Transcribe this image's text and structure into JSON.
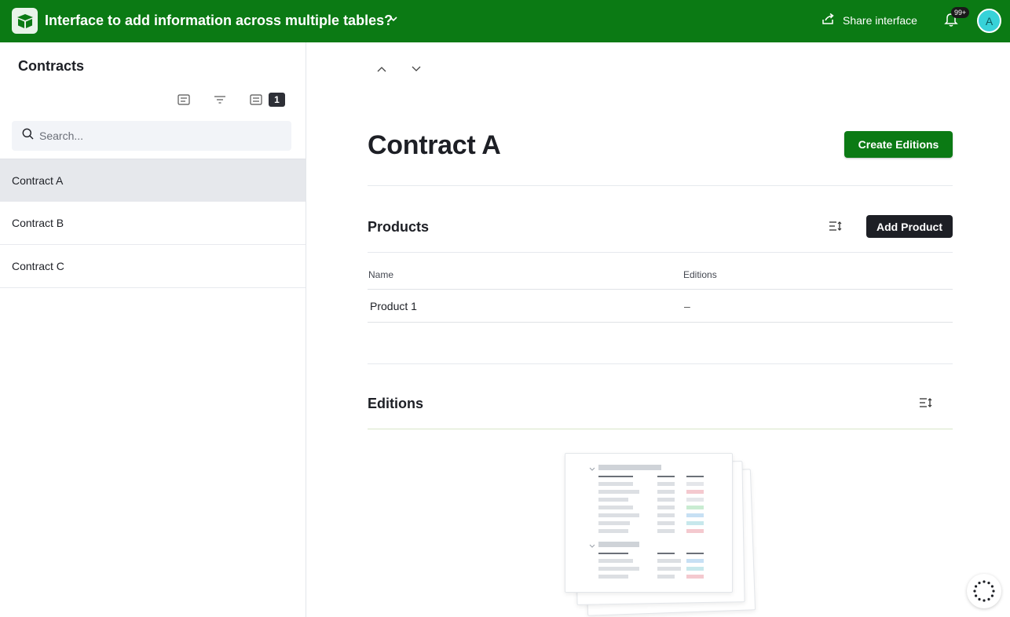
{
  "app": {
    "title": "Interface to add information across multiple tables?",
    "share_label": "Share interface",
    "notification_badge": "99+",
    "avatar_initial": "A",
    "brand_color": "#0b7a14"
  },
  "sidebar": {
    "title": "Contracts",
    "filter_count": "1",
    "search_placeholder": "Search...",
    "records": [
      {
        "label": "Contract A",
        "selected": true
      },
      {
        "label": "Contract B",
        "selected": false
      },
      {
        "label": "Contract C",
        "selected": false
      }
    ],
    "icons": [
      "record-list-icon",
      "filter-icon",
      "group-icon",
      "search-icon"
    ]
  },
  "main": {
    "record_title": "Contract A",
    "primary_button": "Create Editions",
    "products": {
      "title": "Products",
      "add_button": "Add Product",
      "columns": [
        "Name",
        "Editions"
      ],
      "rows": [
        {
          "name": "Product 1",
          "editions": "–"
        }
      ]
    },
    "editions": {
      "title": "Editions"
    },
    "icons": [
      "chevron-up-icon",
      "chevron-down-icon",
      "sort-icon",
      "loading-spinner-icon"
    ]
  }
}
